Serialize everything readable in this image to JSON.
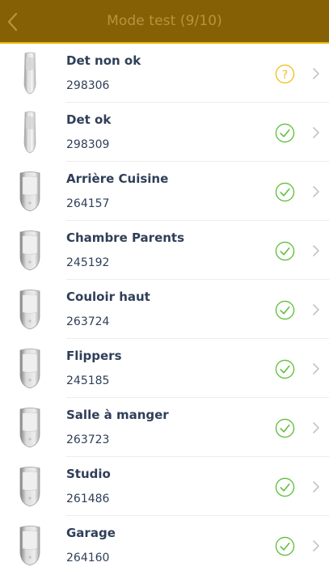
{
  "header": {
    "title": "Mode test (9/10)"
  },
  "colors": {
    "header_bg": "#866005",
    "header_border": "#e9b600",
    "ok": "#5fbe3a",
    "unknown": "#f2bf1e",
    "text": "#2f3f58"
  },
  "items": [
    {
      "name": "Det non ok",
      "serial": "298306",
      "device": "slim-detector-icon",
      "status": "unknown"
    },
    {
      "name": "Det ok",
      "serial": "298309",
      "device": "slim-detector-icon",
      "status": "ok"
    },
    {
      "name": "Arrière Cuisine",
      "serial": "264157",
      "device": "motion-detector-icon",
      "status": "ok"
    },
    {
      "name": "Chambre Parents",
      "serial": "245192",
      "device": "motion-detector-icon",
      "status": "ok"
    },
    {
      "name": "Couloir haut",
      "serial": "263724",
      "device": "motion-detector-icon",
      "status": "ok"
    },
    {
      "name": "Flippers",
      "serial": "245185",
      "device": "motion-detector-icon",
      "status": "ok"
    },
    {
      "name": "Salle à manger",
      "serial": "263723",
      "device": "motion-detector-icon",
      "status": "ok"
    },
    {
      "name": "Studio",
      "serial": "261486",
      "device": "motion-detector-icon",
      "status": "ok"
    },
    {
      "name": "Garage",
      "serial": "264160",
      "device": "motion-detector-icon",
      "status": "ok"
    }
  ]
}
